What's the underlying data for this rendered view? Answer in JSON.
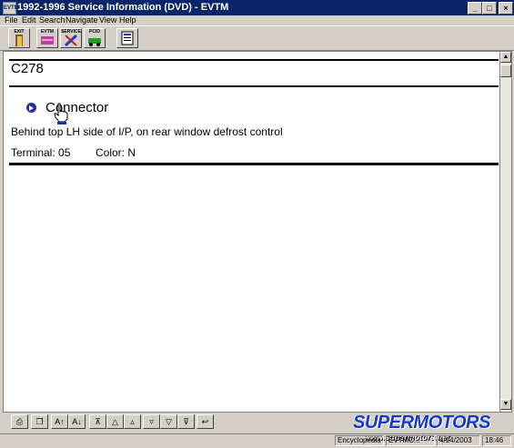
{
  "window": {
    "title": "1992-1996 Service Information (DVD) - EVTM",
    "app_icon_text": "EVTM"
  },
  "menu": [
    "File",
    "Edit",
    "Search",
    "Navigate",
    "View",
    "Help"
  ],
  "toolbar": {
    "exit_label": "EXIT",
    "evtm_label": "EVTM",
    "service_label": "SERVICE",
    "pcid_label": "PCID"
  },
  "document": {
    "heading": "C278",
    "connector_label": "Connector",
    "location": "Behind top LH side of I/P, on rear window defrost control",
    "terminal": "Terminal: 05",
    "color": "Color: N"
  },
  "statusbar": {
    "encyclopedia": "Encyclopedia",
    "field2": "EVTMC...",
    "field3": "4/14/2003",
    "time": "18:46"
  },
  "watermark": {
    "brand": "SUPERMOTORS",
    "url": "www.supermotors.net"
  }
}
